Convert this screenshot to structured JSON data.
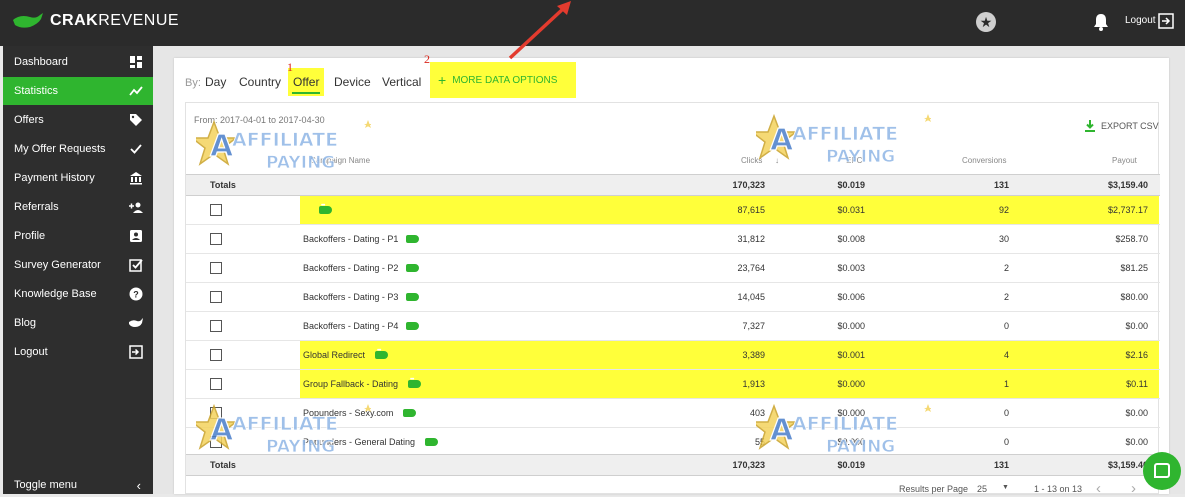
{
  "brand": {
    "name_bold": "CRAK",
    "name_rest": "REVENUE"
  },
  "topbar": {
    "logout_label": "Logout"
  },
  "sidebar": {
    "items": [
      {
        "label": "Dashboard",
        "icon": "grid-icon"
      },
      {
        "label": "Statistics",
        "icon": "trend-icon",
        "active": true
      },
      {
        "label": "Offers",
        "icon": "tag-icon"
      },
      {
        "label": "My Offer Requests",
        "icon": "check-icon"
      },
      {
        "label": "Payment History",
        "icon": "bank-icon"
      },
      {
        "label": "Referrals",
        "icon": "add-user-icon"
      },
      {
        "label": "Profile",
        "icon": "profile-icon"
      },
      {
        "label": "Survey Generator",
        "icon": "edit-check-icon"
      },
      {
        "label": "Knowledge Base",
        "icon": "help-icon"
      },
      {
        "label": "Blog",
        "icon": "whale-icon"
      },
      {
        "label": "Logout",
        "icon": "logout-icon"
      }
    ],
    "toggle_label": "Toggle menu"
  },
  "tabs": {
    "by_label": "By:",
    "items": [
      "Day",
      "Country",
      "Offer",
      "Device",
      "Vertical"
    ],
    "active": "Offer",
    "more_label": "MORE DATA OPTIONS"
  },
  "annotations": {
    "one": "1",
    "two": "2"
  },
  "watermark": {
    "line1": "AFFILIATE",
    "line2": "PAYING"
  },
  "report": {
    "date_range": "From: 2017-04-01 to 2017-04-30",
    "export_label": "EXPORT CSV",
    "columns": {
      "campaign": "Campaign Name",
      "clicks": "Clicks",
      "epc": "EPC",
      "conversions": "Conversions",
      "payout": "Payout"
    },
    "totals": {
      "label": "Totals",
      "clicks": "170,323",
      "epc": "$0.019",
      "conversions": "131",
      "payout": "$3,159.40"
    },
    "rows": [
      {
        "name": "",
        "clicks": "87,615",
        "epc": "$0.031",
        "conversions": "92",
        "payout": "$2,737.17",
        "highlight": true
      },
      {
        "name": "Backoffers - Dating - P1",
        "clicks": "31,812",
        "epc": "$0.008",
        "conversions": "30",
        "payout": "$258.70",
        "highlight": false
      },
      {
        "name": "Backoffers - Dating - P2",
        "clicks": "23,764",
        "epc": "$0.003",
        "conversions": "2",
        "payout": "$81.25",
        "highlight": false
      },
      {
        "name": "Backoffers - Dating - P3",
        "clicks": "14,045",
        "epc": "$0.006",
        "conversions": "2",
        "payout": "$80.00",
        "highlight": false
      },
      {
        "name": "Backoffers - Dating - P4",
        "clicks": "7,327",
        "epc": "$0.000",
        "conversions": "0",
        "payout": "$0.00",
        "highlight": false
      },
      {
        "name": "Global Redirect",
        "clicks": "3,389",
        "epc": "$0.001",
        "conversions": "4",
        "payout": "$2.16",
        "highlight": true
      },
      {
        "name": "Group Fallback - Dating",
        "clicks": "1,913",
        "epc": "$0.000",
        "conversions": "1",
        "payout": "$0.11",
        "highlight": true
      },
      {
        "name": "Popunders - Sexy.com",
        "clicks": "403",
        "epc": "$0.000",
        "conversions": "0",
        "payout": "$0.00",
        "highlight": false
      },
      {
        "name": "Popunders - General Dating",
        "clicks": "55",
        "epc": "$0.000",
        "conversions": "0",
        "payout": "$0.00",
        "highlight": false
      }
    ],
    "pagination": {
      "per_page_label": "Results per Page",
      "per_page_value": "25",
      "range": "1 - 13 on 13"
    }
  }
}
